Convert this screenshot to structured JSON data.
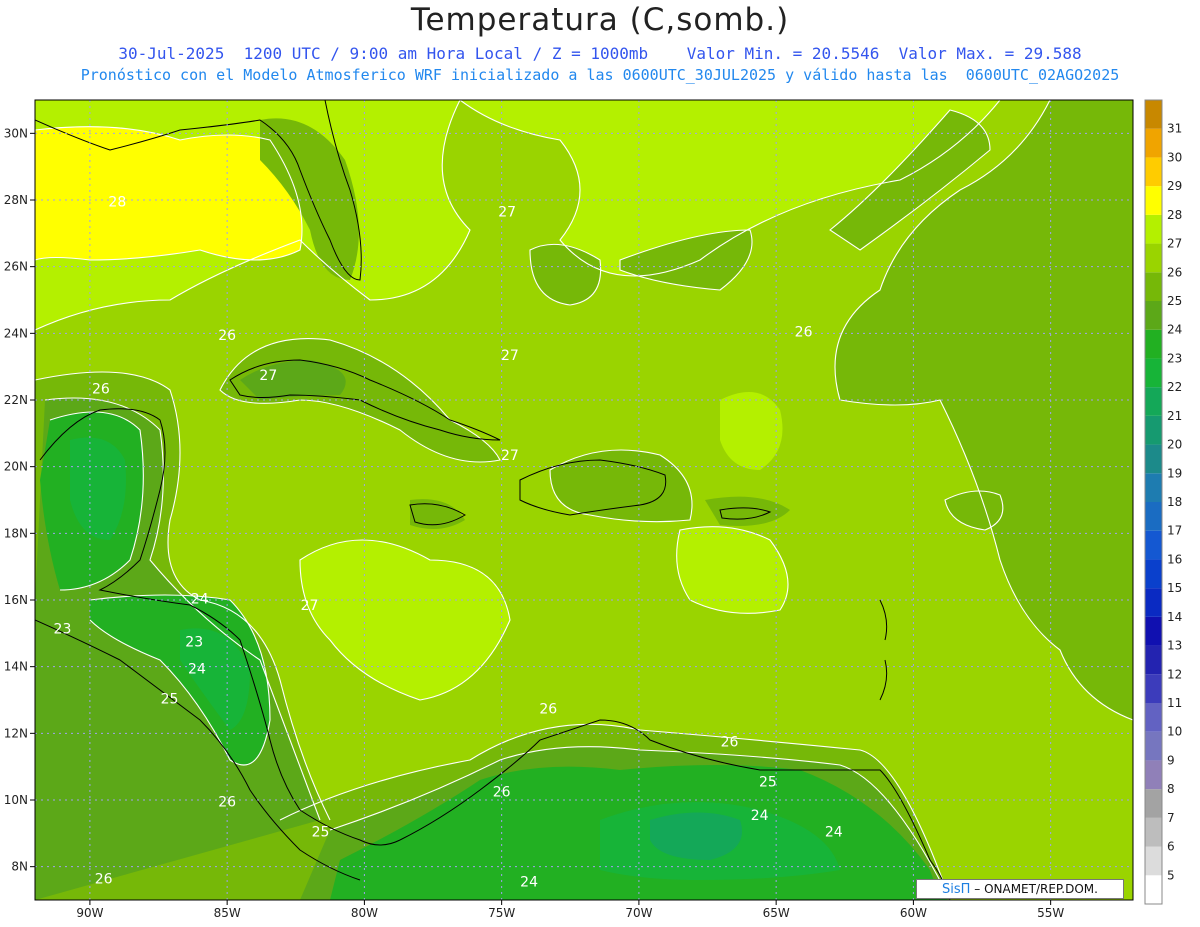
{
  "title": "Temperatura (C,somb.)",
  "subtitle_line1": "30-Jul-2025  1200 UTC / 9:00 am Hora Local / Z = 1000mb    Valor Min. = 20.5546  Valor Max. = 29.588",
  "subtitle_line2": "Pronóstico con el Modelo Atmosferico WRF inicializado a las 0600UTC_30JUL2025 y válido hasta las  0600UTC_02AGO2025",
  "credit": {
    "brand": "SisΠ",
    "org": " – ONAMET/REP.DOM."
  },
  "map": {
    "lon_range": [
      -92,
      -52
    ],
    "lat_range": [
      7,
      31
    ],
    "lon_ticks": [
      {
        "value": -90,
        "label": "90W"
      },
      {
        "value": -85,
        "label": "85W"
      },
      {
        "value": -80,
        "label": "80W"
      },
      {
        "value": -75,
        "label": "75W"
      },
      {
        "value": -70,
        "label": "70W"
      },
      {
        "value": -65,
        "label": "65W"
      },
      {
        "value": -60,
        "label": "60W"
      },
      {
        "value": -55,
        "label": "55W"
      }
    ],
    "lat_ticks": [
      {
        "value": 8,
        "label": "8N"
      },
      {
        "value": 10,
        "label": "10N"
      },
      {
        "value": 12,
        "label": "12N"
      },
      {
        "value": 14,
        "label": "14N"
      },
      {
        "value": 16,
        "label": "16N"
      },
      {
        "value": 18,
        "label": "18N"
      },
      {
        "value": 20,
        "label": "20N"
      },
      {
        "value": 22,
        "label": "22N"
      },
      {
        "value": 24,
        "label": "24N"
      },
      {
        "value": 26,
        "label": "26N"
      },
      {
        "value": 28,
        "label": "28N"
      },
      {
        "value": 30,
        "label": "30N"
      }
    ],
    "contour_labels": [
      {
        "lon": -89.0,
        "lat": 27.8,
        "text": "28"
      },
      {
        "lon": -74.8,
        "lat": 27.5,
        "text": "27"
      },
      {
        "lon": -85.0,
        "lat": 23.8,
        "text": "26"
      },
      {
        "lon": -89.6,
        "lat": 22.2,
        "text": "26"
      },
      {
        "lon": -83.5,
        "lat": 22.6,
        "text": "27"
      },
      {
        "lon": -74.7,
        "lat": 23.2,
        "text": "27"
      },
      {
        "lon": -74.7,
        "lat": 20.2,
        "text": "27"
      },
      {
        "lon": -64.0,
        "lat": 23.9,
        "text": "26"
      },
      {
        "lon": -86.0,
        "lat": 15.9,
        "text": "24"
      },
      {
        "lon": -82.0,
        "lat": 15.7,
        "text": "27"
      },
      {
        "lon": -91.0,
        "lat": 15.0,
        "text": "23"
      },
      {
        "lon": -86.2,
        "lat": 14.6,
        "text": "23"
      },
      {
        "lon": -86.1,
        "lat": 13.8,
        "text": "24"
      },
      {
        "lon": -87.1,
        "lat": 12.9,
        "text": "25"
      },
      {
        "lon": -85.0,
        "lat": 9.8,
        "text": "26"
      },
      {
        "lon": -81.6,
        "lat": 8.9,
        "text": "25"
      },
      {
        "lon": -89.5,
        "lat": 7.5,
        "text": "26"
      },
      {
        "lon": -73.3,
        "lat": 12.6,
        "text": "26"
      },
      {
        "lon": -66.7,
        "lat": 11.6,
        "text": "26"
      },
      {
        "lon": -75.0,
        "lat": 10.1,
        "text": "26"
      },
      {
        "lon": -65.3,
        "lat": 10.4,
        "text": "25"
      },
      {
        "lon": -65.6,
        "lat": 9.4,
        "text": "24"
      },
      {
        "lon": -62.9,
        "lat": 8.9,
        "text": "24"
      },
      {
        "lon": -74.0,
        "lat": 7.4,
        "text": "24"
      }
    ]
  },
  "colorbar": {
    "levels": [
      5,
      6,
      7,
      8,
      9,
      10,
      11,
      12,
      13,
      14,
      15,
      16,
      17,
      18,
      19,
      20,
      21,
      22,
      23,
      24,
      25,
      26,
      27,
      28,
      29,
      30,
      31
    ],
    "colors": [
      "#ffffff",
      "#dcdcdc",
      "#bdbdbd",
      "#a3a3a3",
      "#9080b8",
      "#7676bf",
      "#6262c2",
      "#3c3cbb",
      "#2323b0",
      "#1010b0",
      "#0a2ac2",
      "#0a40cc",
      "#1458d2",
      "#1a6cc2",
      "#1e7cb0",
      "#1c8a8a",
      "#169a70",
      "#14a858",
      "#17b438",
      "#22b022",
      "#5ca818",
      "#76b808",
      "#9ad400",
      "#b4f000",
      "#ffff00",
      "#ffcc00",
      "#f0a400",
      "#c88800"
    ]
  },
  "palette": {
    "c25": "#5ca818",
    "c26": "#76b808",
    "c27": "#9ad400",
    "c28": "#b4f000",
    "c29": "#ffff00",
    "c24": "#22b022",
    "c23": "#17b438",
    "c22": "#14a858"
  }
}
